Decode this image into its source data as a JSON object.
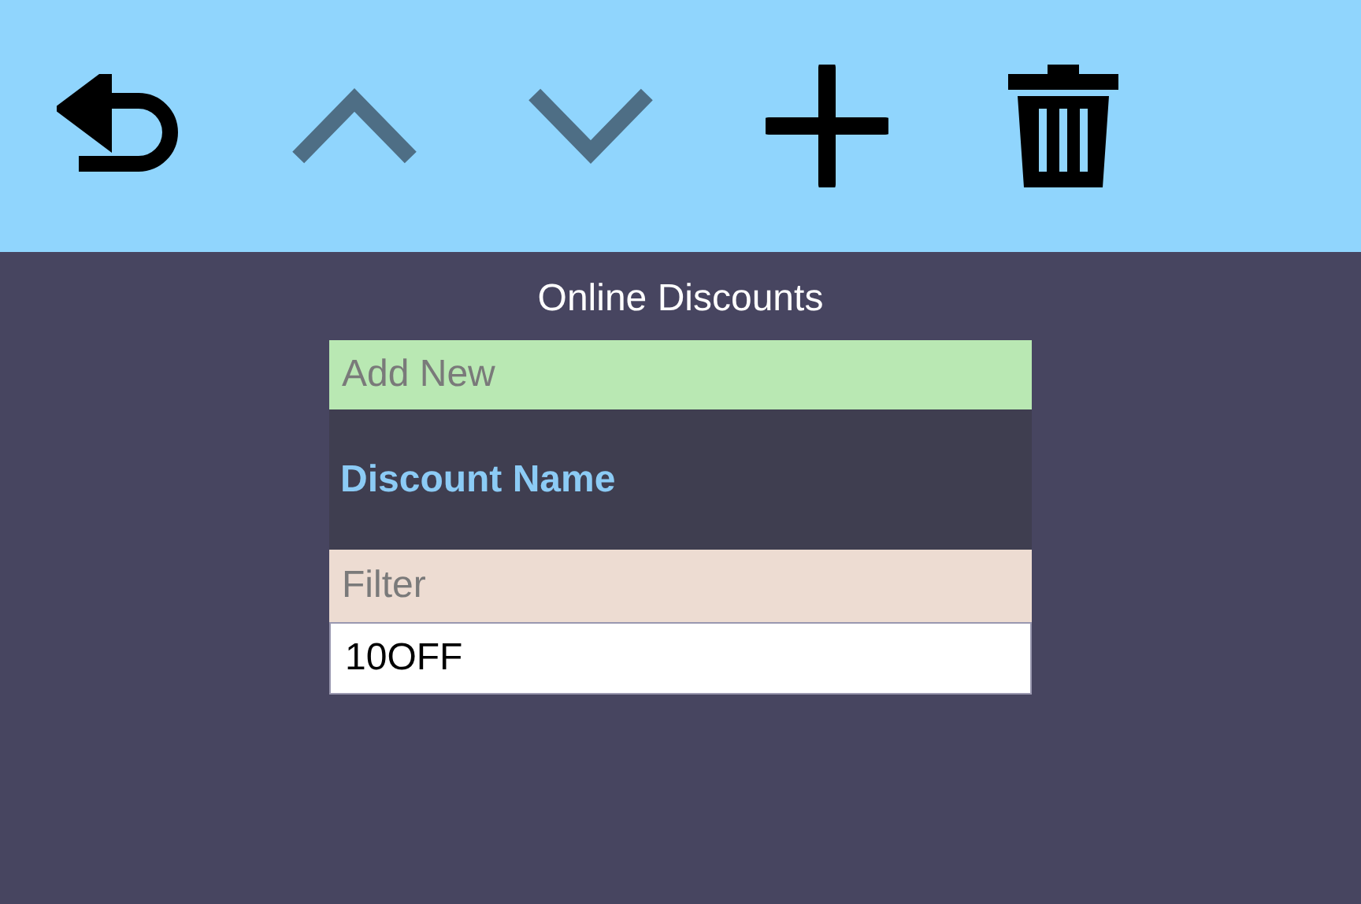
{
  "toolbar": [
    {
      "kind": "back",
      "disabled": false
    },
    {
      "kind": "up",
      "disabled": true
    },
    {
      "kind": "down",
      "disabled": true
    },
    {
      "kind": "add",
      "disabled": false
    },
    {
      "kind": "delete",
      "disabled": false
    }
  ],
  "title": "Online Discounts",
  "add_new": {
    "placeholder": "Add New"
  },
  "table": {
    "columns": [
      "Discount Name"
    ],
    "filter": {
      "placeholder": "Filter"
    },
    "rows": [
      {
        "cells": [
          "10OFF"
        ]
      }
    ]
  }
}
